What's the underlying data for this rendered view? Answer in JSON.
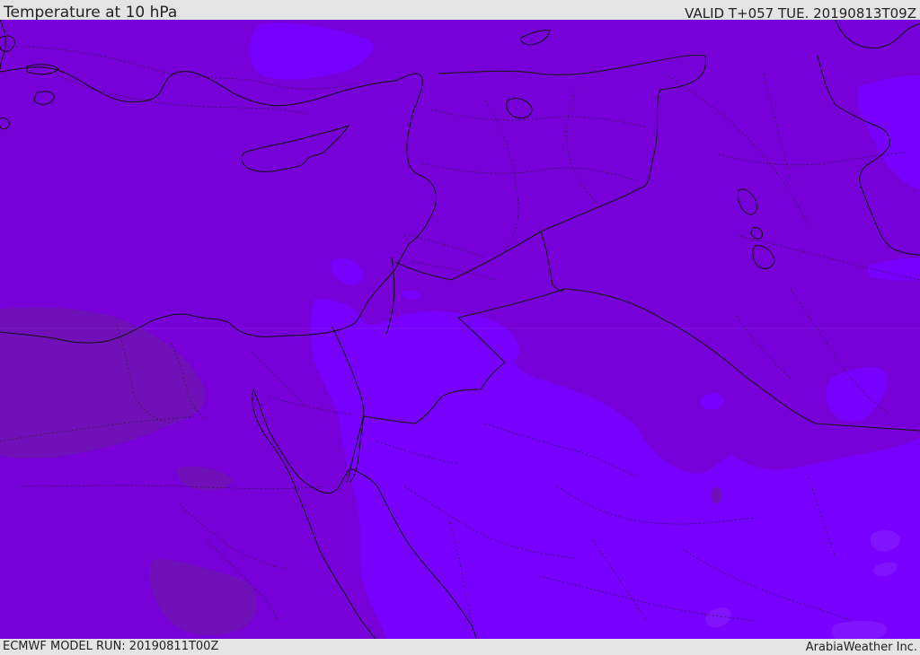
{
  "header": {
    "title": "Temperature at 10 hPa",
    "valid_time": "VALID T+057 TUE. 20190813T09Z"
  },
  "footer": {
    "model_run": "ECMWF MODEL RUN: 20190811T00Z",
    "credit": "ArabiaWeather Inc."
  },
  "map": {
    "variable": "temperature",
    "level": "10 hPa",
    "colors": {
      "base": "#7700d9",
      "warm_band": "#7700ff",
      "warm_spot": "#8213ff",
      "cool_band": "#7010b8",
      "coast_line": "#111111",
      "border_line": "#222222"
    }
  }
}
